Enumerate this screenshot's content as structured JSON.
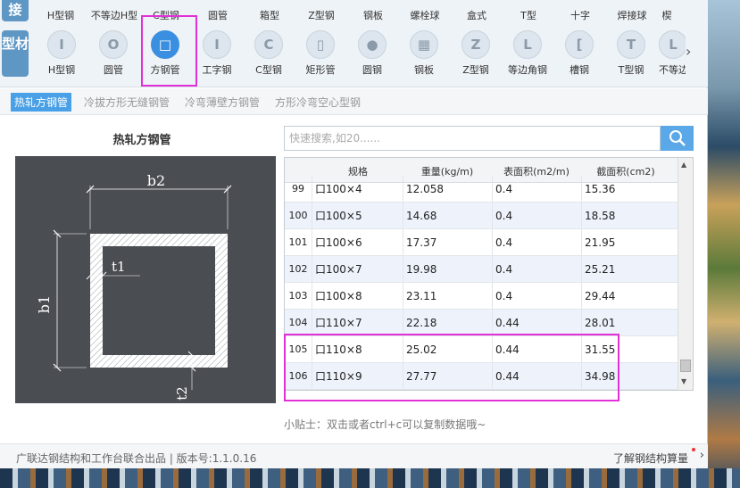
{
  "side_tags": {
    "top": "接",
    "profile": "型材"
  },
  "top_row_items": [
    "H型钢",
    "不等边H型",
    "C型钢",
    "圆管",
    "箱型",
    "Z型钢",
    "钢板",
    "螺栓球",
    "盒式",
    "T型",
    "十字",
    "焊接球",
    "楔"
  ],
  "categories": [
    {
      "label": "H型钢",
      "glyph": "I"
    },
    {
      "label": "圆管",
      "glyph": "O"
    },
    {
      "label": "方钢管",
      "glyph": "□"
    },
    {
      "label": "工字钢",
      "glyph": "I"
    },
    {
      "label": "C型钢",
      "glyph": "C"
    },
    {
      "label": "矩形管",
      "glyph": "▯"
    },
    {
      "label": "圆钢",
      "glyph": "●"
    },
    {
      "label": "钢板",
      "glyph": "▦"
    },
    {
      "label": "Z型钢",
      "glyph": "Z"
    },
    {
      "label": "等边角钢",
      "glyph": "L"
    },
    {
      "label": "槽钢",
      "glyph": "["
    },
    {
      "label": "T型钢",
      "glyph": "T"
    },
    {
      "label": "不等边",
      "glyph": "L"
    }
  ],
  "active_category": "方钢管",
  "subtabs": [
    "热轧方钢管",
    "冷拔方形无缝钢管",
    "冷弯薄壁方钢管",
    "方形冷弯空心型钢"
  ],
  "figure": {
    "title": "热轧方钢管",
    "b1": "b1",
    "b2": "b2",
    "t1": "t1",
    "t2": "t2"
  },
  "search": {
    "placeholder": "快速搜索,如20......"
  },
  "table": {
    "headers": [
      "规格",
      "重量(kg/m)",
      "表面积(m2/m)",
      "截面积(cm2)"
    ],
    "rows": [
      {
        "idx": "99",
        "spec": "口100×4",
        "weight": "12.058",
        "area_surface": "0.4",
        "area_section": "15.36"
      },
      {
        "idx": "100",
        "spec": "口100×5",
        "weight": "14.68",
        "area_surface": "0.4",
        "area_section": "18.58"
      },
      {
        "idx": "101",
        "spec": "口100×6",
        "weight": "17.37",
        "area_surface": "0.4",
        "area_section": "21.95"
      },
      {
        "idx": "102",
        "spec": "口100×7",
        "weight": "19.98",
        "area_surface": "0.4",
        "area_section": "25.21"
      },
      {
        "idx": "103",
        "spec": "口100×8",
        "weight": "23.11",
        "area_surface": "0.4",
        "area_section": "29.44"
      },
      {
        "idx": "104",
        "spec": "口110×7",
        "weight": "22.18",
        "area_surface": "0.44",
        "area_section": "28.01"
      },
      {
        "idx": "105",
        "spec": "口110×8",
        "weight": "25.02",
        "area_surface": "0.44",
        "area_section": "31.55"
      },
      {
        "idx": "106",
        "spec": "口110×9",
        "weight": "27.77",
        "area_surface": "0.44",
        "area_section": "34.98"
      }
    ]
  },
  "tip": "小贴士：双击或者ctrl+c可以复制数据哦~",
  "footer": {
    "left": "广联达钢结构和工作台联合出品 | 版本号:1.1.0.16",
    "right": "了解钢结构算量"
  },
  "colors": {
    "accent": "#3a8fe0",
    "highlight": "#e030d8",
    "figure_bg": "#4a4d52"
  }
}
